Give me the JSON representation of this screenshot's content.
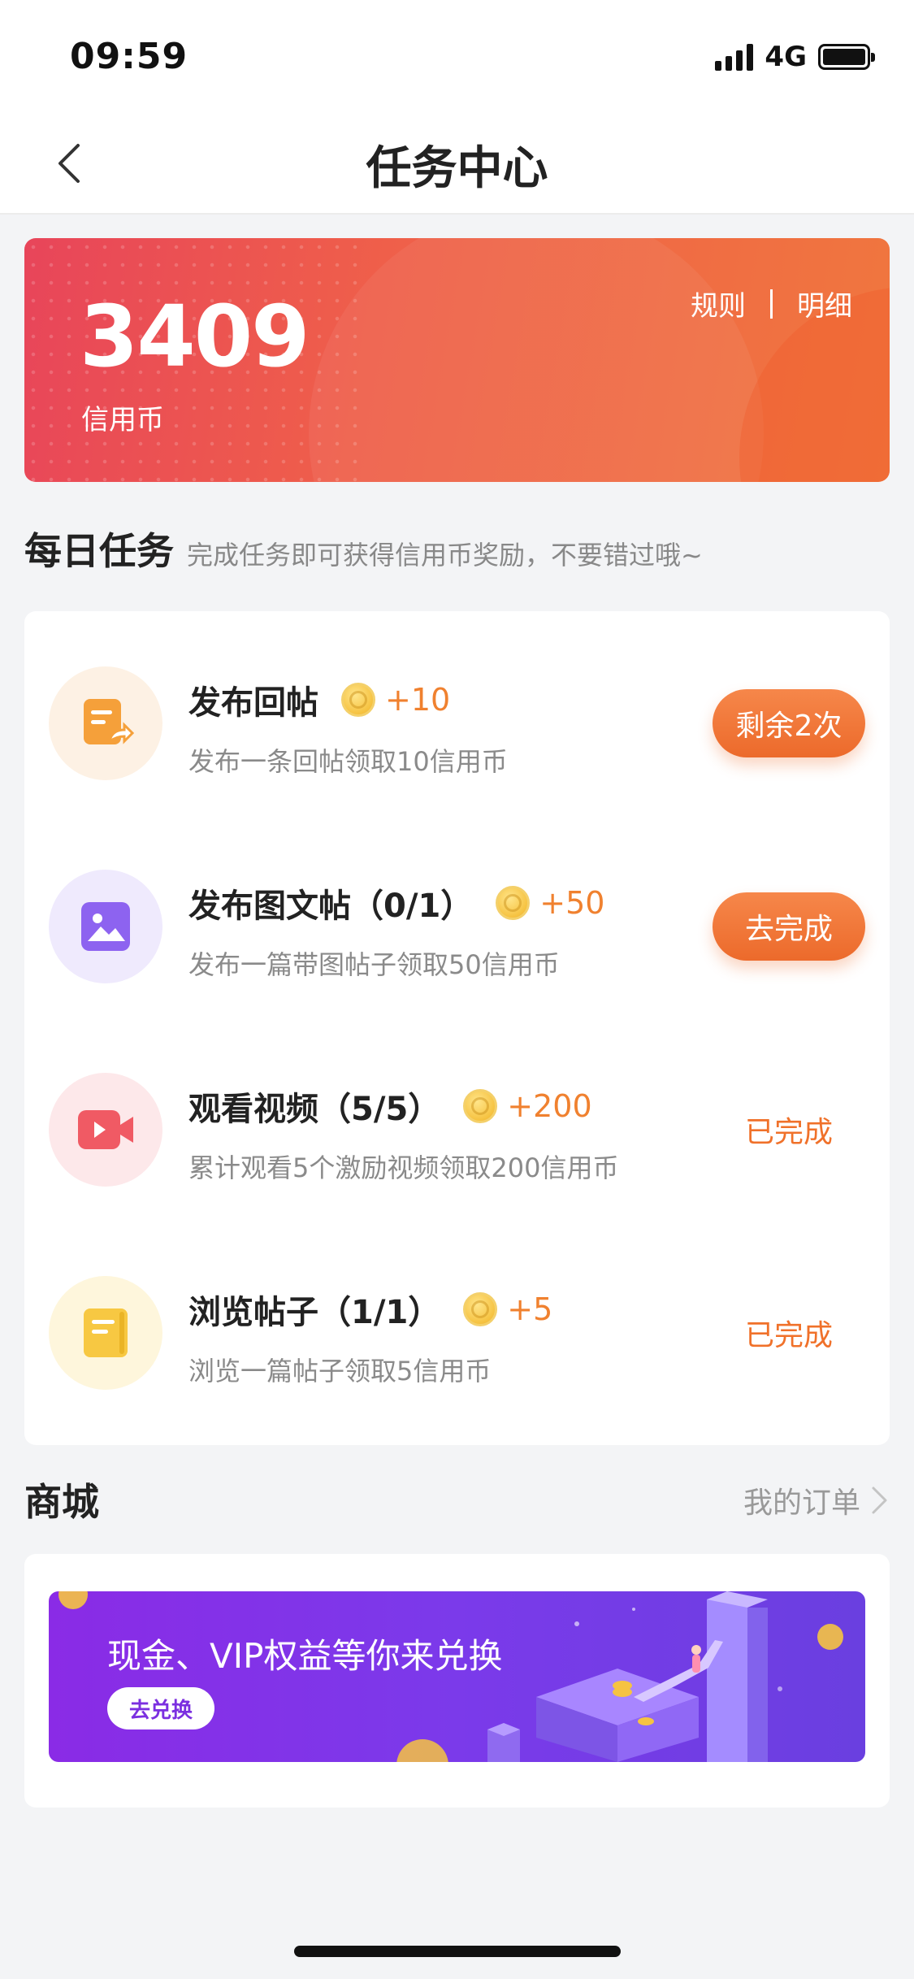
{
  "status": {
    "time": "09:59",
    "network": "4G"
  },
  "nav": {
    "title": "任务中心"
  },
  "credit": {
    "value": "3409",
    "label": "信用币",
    "rules_link": "规则",
    "detail_link": "明细"
  },
  "daily": {
    "title": "每日任务",
    "subtitle": "完成任务即可获得信用币奖励，不要错过哦~",
    "tasks": [
      {
        "title": "发布回帖",
        "reward": "+10",
        "desc": "发布一条回帖领取10信用币",
        "action": "剩余2次",
        "icon": "reply-post-icon",
        "color": "#f7a03a"
      },
      {
        "title": "发布图文帖（0/1）",
        "reward": "+50",
        "desc": "发布一篇带图帖子领取50信用币",
        "action": "去完成",
        "icon": "image-post-icon",
        "color": "#8d63f0"
      },
      {
        "title": "观看视频（5/5）",
        "reward": "+200",
        "desc": "累计观看5个激励视频领取200信用币",
        "action": "已完成",
        "icon": "video-icon",
        "color": "#f05a64"
      },
      {
        "title": "浏览帖子（1/1）",
        "reward": "+5",
        "desc": "浏览一篇帖子领取5信用币",
        "action": "已完成",
        "icon": "browse-post-icon",
        "color": "#f7c842"
      }
    ]
  },
  "mall": {
    "title": "商城",
    "orders_link": "我的订单",
    "banner_text": "现金、VIP权益等你来兑换",
    "banner_button": "去兑换"
  },
  "colors": {
    "accent": "#f0712a",
    "card_start": "#e8455a",
    "card_end": "#f0773e",
    "banner": "#7b3aea"
  }
}
